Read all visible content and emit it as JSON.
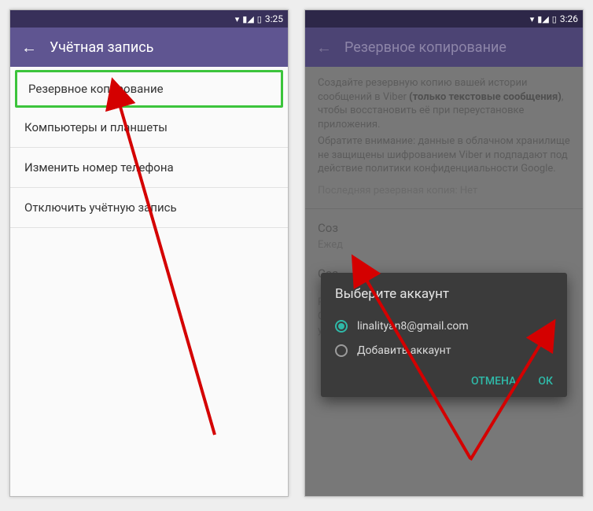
{
  "left": {
    "status_time": "3:25",
    "appbar_title": "Учётная запись",
    "items": [
      "Резервное копирование",
      "Компьютеры и планшеты",
      "Изменить номер телефона",
      "Отключить учётную запись"
    ]
  },
  "right": {
    "status_time": "3:26",
    "appbar_title": "Резервное копирование",
    "descr_pre": "Создайте резервную копию вашей истории сообщений в Viber ",
    "descr_bold": "(только текстовые сообщения)",
    "descr_post": ", чтобы восстановить её при переустановке приложения.",
    "descr_note": "Обратите внимание: данные в облачном хранилище не защищены шифрованием Viber и подпадают под действие политики конфиденциальности Google.",
    "last_backup": "Последняя резервная копия: Нет",
    "sec1_title": "Соз",
    "sec1_sub": "Ежед",
    "sec2_title": "Соз",
    "restore_text": "Ре\nGoo\nучё",
    "dialog": {
      "title": "Выберите аккаунт",
      "account": "linalityan8@gmail.com",
      "add": "Добавить аккаунт",
      "cancel": "ОТМЕНА",
      "ok": "ОК"
    }
  }
}
